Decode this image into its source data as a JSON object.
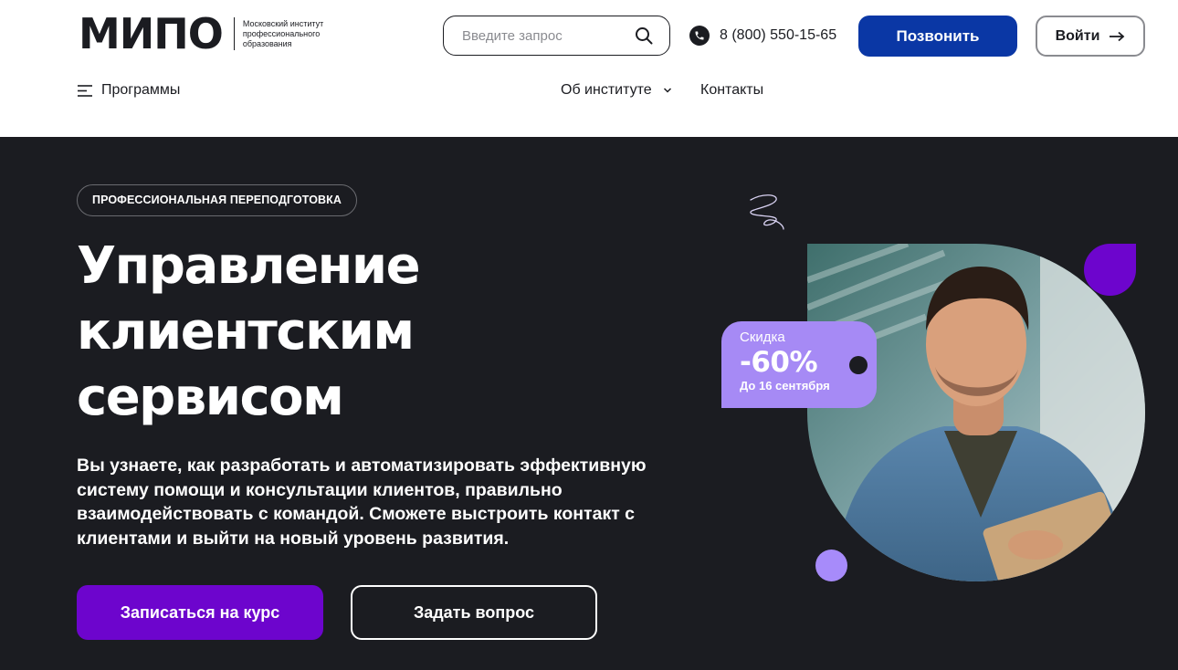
{
  "header": {
    "logo": {
      "wordmark": "МИПО",
      "subtitle": "Московский институт профессионального образования"
    },
    "search": {
      "placeholder": "Введите запрос",
      "icon": "search-icon"
    },
    "phone": {
      "number": "8 (800) 550-15-65",
      "icon": "phone-icon"
    },
    "call_button": "Позвонить",
    "login_button": "Войти",
    "nav": {
      "programs": "Программы",
      "about": "Об институте",
      "contacts": "Контакты"
    }
  },
  "hero": {
    "badge": "ПРОФЕССИОНАЛЬНАЯ ПЕРЕПОДГОТОВКА",
    "title_lines": [
      "Управление",
      "клиентским",
      "сервисом"
    ],
    "description": "Вы узнаете, как разработать и автоматизировать эффективную систему помощи и консультации клиентов, правильно взаимодействовать с командой. Сможете выстроить контакт с клиентами и выйти на новый уровень развития.",
    "enroll_button": "Записаться на курс",
    "ask_button": "Задать вопрос",
    "discount": {
      "label": "Скидка",
      "value": "-60%",
      "until": "До 16 сентября"
    }
  },
  "colors": {
    "brand_blue": "#0a37a5",
    "brand_purple": "#6d05cd",
    "lilac": "#a68af5",
    "dark_bg": "#1b1c21"
  }
}
